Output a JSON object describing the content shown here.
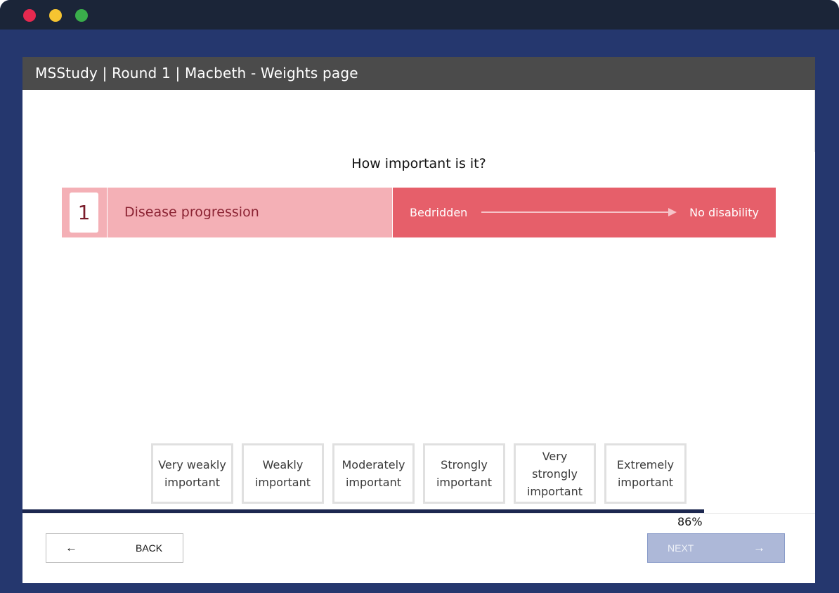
{
  "window": {
    "controls": [
      "close",
      "minimize",
      "maximize"
    ],
    "colors": {
      "frame": "#25376e",
      "titlebar": "#1b2538",
      "close": "#e6294f",
      "minimize": "#f6c431",
      "maximize": "#3aad4b"
    }
  },
  "header": {
    "title": "MSStudy | Round 1 | Macbeth - Weights page"
  },
  "main": {
    "question": "How important is it?",
    "criterion": {
      "number": "1",
      "name": "Disease progression",
      "range_low": "Bedridden",
      "range_high": "No disability",
      "colors": {
        "name_bg": "#f4b0b6",
        "range_bg": "#e65f6a",
        "text": "#8b2333"
      }
    },
    "options": [
      {
        "label": "Very weakly\nimportant"
      },
      {
        "label": "Weakly\nimportant"
      },
      {
        "label": "Moderately\nimportant"
      },
      {
        "label": "Strongly\nimportant"
      },
      {
        "label": "Very strongly\nimportant"
      },
      {
        "label": "Extremely\nimportant"
      }
    ]
  },
  "progress": {
    "percent": 86,
    "label": "86%",
    "color": "#1d2850"
  },
  "footer": {
    "back_label": "BACK",
    "back_icon": "arrow-left-icon",
    "next_label": "NEXT",
    "next_icon": "arrow-right-icon",
    "next_disabled": true
  }
}
